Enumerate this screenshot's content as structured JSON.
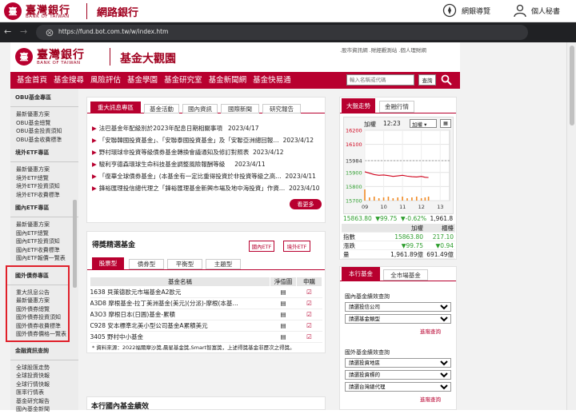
{
  "outer_header": {
    "logo_cn": "臺灣銀行",
    "logo_en": "BANK OF TAIWAN",
    "title": "網路銀行",
    "links": [
      {
        "icon": "compass-icon",
        "label": "網銀導覽"
      },
      {
        "icon": "person-icon",
        "label": "個人秘書"
      }
    ]
  },
  "browser": {
    "url": "https://fund.bot.com.tw/w/index.htm"
  },
  "site": {
    "logo_cn": "臺灣銀行",
    "logo_en": "BANK OF TAIWAN",
    "title": "基金大觀園",
    "top_links": ".股市資訊網 .財經觀測站 .個人理財網",
    "nav": [
      "基金首頁",
      "基金搜尋",
      "風險評估",
      "基金學園",
      "基金研究室",
      "基金新聞網",
      "基金快易通"
    ],
    "search_placeholder": "輸入名稱或代碼",
    "search_button": "查詢"
  },
  "left_panel": {
    "sections": [
      {
        "title": "OBU基金專區",
        "items": [
          "最新優惠方案",
          "OBU基金總覽",
          "OBU基金投資須知",
          "OBU基金收費標準"
        ]
      },
      {
        "title": "境外ETF專區",
        "items": [
          "最新優惠方案",
          "境外ETF總覽",
          "境外ETF投資須知",
          "境外ETF收費標準"
        ]
      },
      {
        "title": "國內ETF專區",
        "items": [
          "最新優惠方案",
          "國內ETF總覽",
          "國內ETF投資須知",
          "國內ETF收費標準",
          "國內ETF報價一覽表"
        ]
      },
      {
        "title": "國外債券專區",
        "items": [
          "重大訊息公告",
          "最新優惠方案",
          "國外債券總覽",
          "國外債券投資須知",
          "國外債券收費標準",
          "國外債券價格一覽表"
        ]
      },
      {
        "title": "金融資訊查詢",
        "items": [
          "全球股匯走勢",
          "全球投資快報",
          "全球行情快報",
          "匯率行情表",
          "基金研究報告",
          "國內基金新聞"
        ]
      }
    ]
  },
  "news": {
    "tabs": [
      "重大訊息專區",
      "基金活動",
      "國內資訊",
      "國際新聞",
      "研究報告"
    ],
    "items": [
      {
        "text": "法巴基金年配級別於2023年配息日期相關事項",
        "date": "2023/4/17"
      },
      {
        "text": "「安聯韓國投資基金」、「安聯泰國投資基金」及「安聯亞洲總回報…",
        "date": "2023/4/12"
      },
      {
        "text": "野村環球非投資等級債券基金轉換會議通知及修訂對照表",
        "date": "2023/4/12"
      },
      {
        "text": "駿利亨德森環球生命科技基金調整風險報酬等級",
        "date": "2023/4/11"
      },
      {
        "text": "「復華全球債券基金」(本基金有一定比重得投資於非投資等級之高…",
        "date": "2023/4/11"
      },
      {
        "text": "鋒裕匯理投信總代理之「鋒裕匯理基金新興市場及地中海投資」作資…",
        "date": "2023/4/10"
      }
    ],
    "more": "看更多"
  },
  "awards": {
    "title": "得獎精選基金",
    "links": [
      "國內ETF",
      "境外ETF"
    ],
    "tabs": [
      "股票型",
      "債券型",
      "平衡型",
      "主題型"
    ],
    "columns": [
      "基金名稱",
      "淨值圖",
      "申購"
    ],
    "rows": [
      "1638 貝萊德歐元市場基金A2歐元",
      "A3D8 摩根基金-拉丁美洲基金(美元)(分派)-摩根(本基…",
      "A3O3 摩根日本(日圓)基金-累積",
      "C928 安本標準北美小型公司基金A累積美元",
      "3405 野村中小基金"
    ],
    "note": "資料來源：2022福爾摩沙獎,晨星基金獎,Smart智富獎，上述得獎基金非歷次之得獎。"
  },
  "bottom_section": {
    "title": "本行國內基金績效"
  },
  "market": {
    "tabs": [
      "大盤走勢",
      "金融行情"
    ],
    "chart_header": {
      "index_label": "加權",
      "time": "12:23",
      "select": "加權"
    },
    "y_ticks": [
      "16200",
      "16100",
      "15984",
      "15900",
      "15800",
      "15700"
    ],
    "x_ticks": [
      "09",
      "10",
      "11",
      "12",
      "13"
    ],
    "readout": {
      "value": "15863.80",
      "change": "▼99.75",
      "pct": "▼-0.62%",
      "vol": "1,961.8"
    },
    "table": {
      "headers": [
        "",
        "加權",
        "櫃檯"
      ],
      "rows": [
        [
          "指數",
          "15863.80",
          "217.10"
        ],
        [
          "漲跌",
          "▼99.75",
          "▼0.94"
        ],
        [
          "量",
          "1,961.89億",
          "691.49億"
        ]
      ]
    },
    "colors": {
      "up": "#d0021b",
      "down": "#2e9e2e",
      "accent": "#b8002f"
    }
  },
  "fund_perf": {
    "tabs": [
      "本行基金",
      "全市場基金"
    ],
    "group1_title": "國內基金績效查詢",
    "group1_selects": [
      "請選投信公司",
      "請選基金類型"
    ],
    "group2_title": "國外基金績效查詢",
    "group2_selects": [
      "請選投資地區",
      "請選投資標的",
      "請選台灣總代理"
    ],
    "query": "進階查詢"
  },
  "chart_data": {
    "type": "line",
    "title": "",
    "xlabel": "",
    "ylabel": "",
    "x_ticks": [
      "09",
      "10",
      "11",
      "12",
      "13"
    ],
    "ylim": [
      15700,
      16200
    ],
    "reference": 15984,
    "series": [
      {
        "x": [
          9.0,
          9.25,
          9.5,
          9.75,
          10.0,
          10.25,
          10.5,
          10.75,
          11.0,
          11.25,
          11.5,
          11.75,
          12.0,
          12.2,
          12.38
        ],
        "values": [
          15905,
          15895,
          15885,
          15880,
          15882,
          15878,
          15872,
          15876,
          15880,
          15874,
          15870,
          15868,
          15872,
          15866,
          15864
        ]
      }
    ]
  }
}
